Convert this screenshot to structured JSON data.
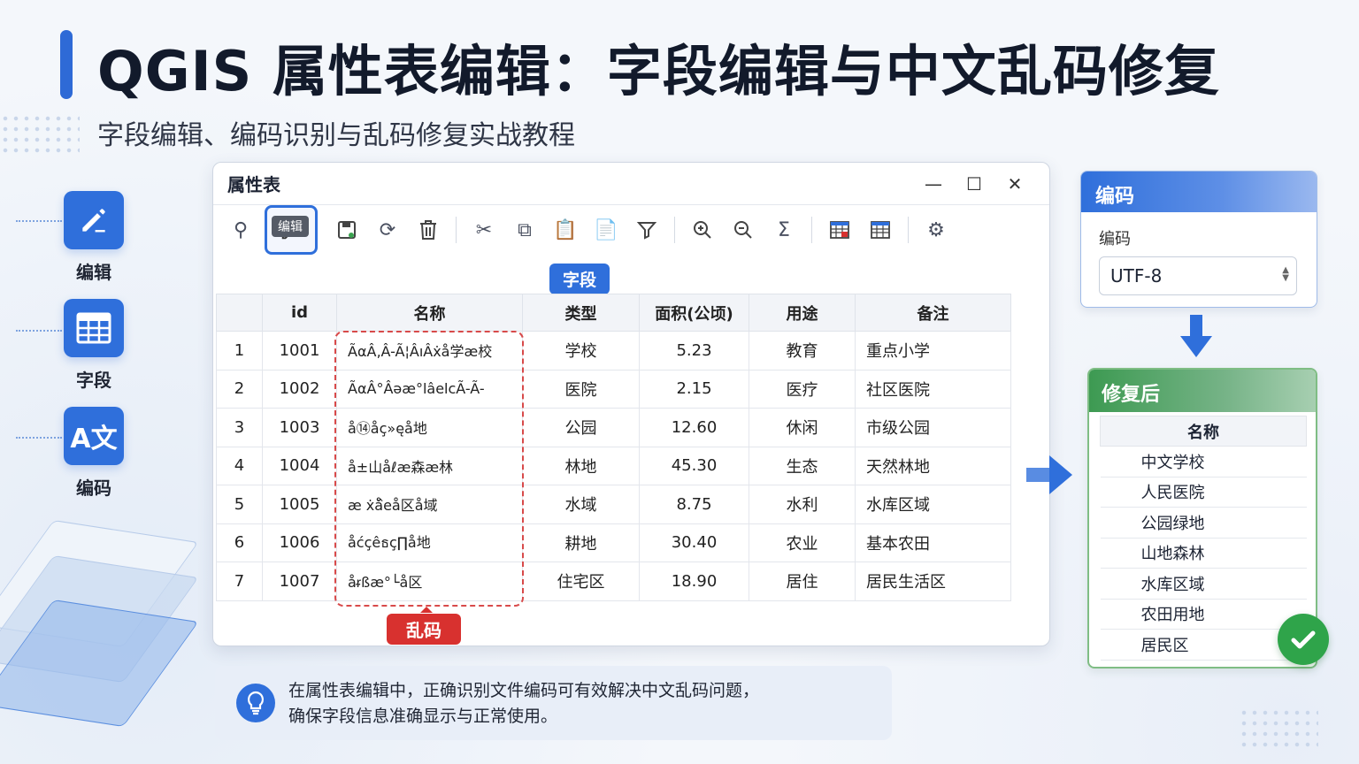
{
  "header": {
    "title": "QGIS 属性表编辑：字段编辑与中文乱码修复",
    "subtitle": "字段编辑、编码识别与乱码修复实战教程"
  },
  "sidebar": {
    "items": [
      {
        "label": "编辑",
        "icon": "pencil-icon"
      },
      {
        "label": "字段",
        "icon": "table-icon"
      },
      {
        "label": "编码",
        "icon": "translate-icon"
      }
    ]
  },
  "window": {
    "title": "属性表",
    "controls": {
      "minimize": "—",
      "maximize": "☐",
      "close": "✕"
    },
    "tooltip": "编辑",
    "field_tag": "字段",
    "garbled_tag": "乱码",
    "table": {
      "headers": [
        "",
        "id",
        "名称",
        "类型",
        "面积(公顷)",
        "用途",
        "备注"
      ],
      "rows": [
        [
          "1",
          "1001",
          "ÃαÂ‚Â-Ã¦ÂıÂẋå学æ校",
          "学校",
          "5.23",
          "教育",
          "重点小学"
        ],
        [
          "2",
          "1002",
          "ÃαÂ°Âǝæ°lâelcÃ-Ã-",
          "医院",
          "2.15",
          "医疗",
          "社区医院"
        ],
        [
          "3",
          "1003",
          "å⑭åç»ęå地",
          "公园",
          "12.60",
          "休闲",
          "市级公园"
        ],
        [
          "4",
          "1004",
          "å±山åℓæ森æ林",
          "林地",
          "45.30",
          "生态",
          "天然林地"
        ],
        [
          "5",
          "1005",
          "æ ẋå᷈eå区å域",
          "水域",
          "8.75",
          "水利",
          "水库区域"
        ],
        [
          "6",
          "1006",
          "åćçêธç∏å地",
          "耕地",
          "30.40",
          "农业",
          "基本农田"
        ],
        [
          "7",
          "1007",
          "åᵲßæ°└å区",
          "住宅区",
          "18.90",
          "居住",
          "居民生活区"
        ]
      ]
    }
  },
  "encoding_panel": {
    "title": "编码",
    "label": "编码",
    "value": "UTF-8"
  },
  "fixed_panel": {
    "title": "修复后",
    "header": "名称",
    "items": [
      "中文学校",
      "人民医院",
      "公园绿地",
      "山地森林",
      "水库区域",
      "农田用地",
      "居民区"
    ]
  },
  "tip": {
    "line1": "在属性表编辑中，正确识别文件编码可有效解决中文乱码问题，",
    "line2": "确保字段信息准确显示与正常使用。"
  },
  "colors": {
    "accent": "#2f6fdb",
    "error": "#d8312f",
    "success": "#2fa44a"
  }
}
